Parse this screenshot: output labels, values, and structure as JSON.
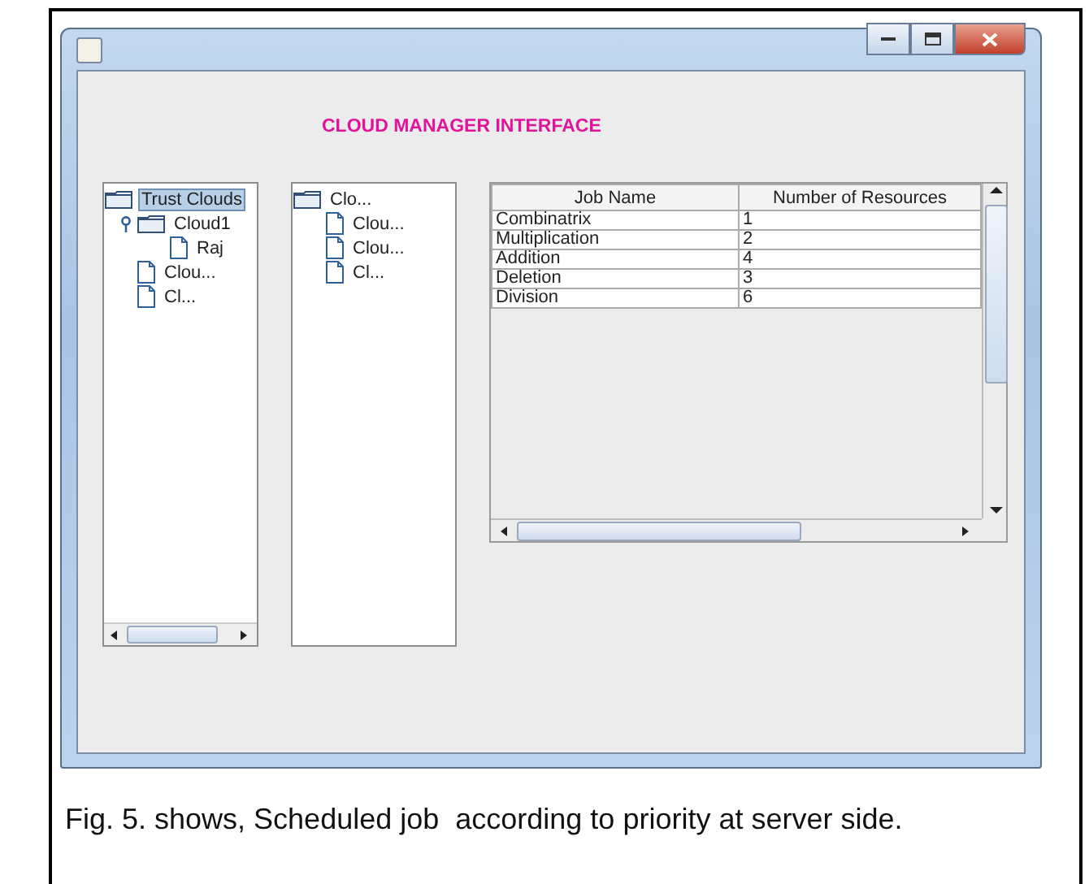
{
  "window": {
    "title": "CLOUD MANAGER INTERFACE"
  },
  "trees": [
    {
      "nodes": [
        {
          "label": "Trust Clouds",
          "kind": "folder",
          "selected": true,
          "children": [
            {
              "label": "Cloud1",
              "kind": "folder",
              "selected": false,
              "expanded": true,
              "children": [
                {
                  "label": "Raj",
                  "kind": "file",
                  "selected": false
                }
              ]
            },
            {
              "label": "Clou...",
              "kind": "file",
              "selected": false
            },
            {
              "label": "Cl...",
              "kind": "file",
              "selected": false
            }
          ]
        }
      ],
      "horizontal_scrollbar": true
    },
    {
      "nodes": [
        {
          "label": "Clo...",
          "kind": "folder",
          "selected": false,
          "children": [
            {
              "label": "Clou...",
              "kind": "file",
              "selected": false
            },
            {
              "label": "Clou...",
              "kind": "file",
              "selected": false
            },
            {
              "label": "Cl...",
              "kind": "file",
              "selected": false
            }
          ]
        }
      ],
      "horizontal_scrollbar": false
    }
  ],
  "table": {
    "columns": [
      "Job Name",
      "Number of Resources"
    ],
    "rows": [
      [
        "Combinatrix",
        "1"
      ],
      [
        "Multiplication",
        "2"
      ],
      [
        "Addition",
        "4"
      ],
      [
        "Deletion",
        "3"
      ],
      [
        "Division",
        "6"
      ]
    ]
  },
  "caption": "Fig. 5. shows, Scheduled job  according to priority at server side."
}
